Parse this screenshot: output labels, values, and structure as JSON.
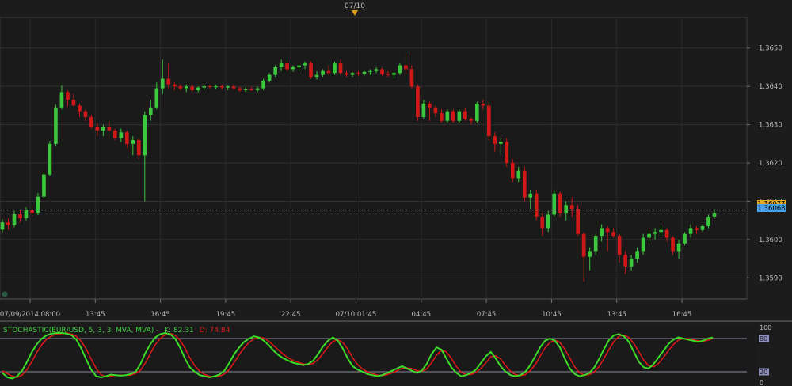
{
  "chart_data": [
    {
      "type": "candlestick",
      "instrument": "EUR/USD",
      "date_marker": "07/10",
      "x_tick_labels": [
        "07/09/2014 08:00",
        "13:45",
        "16:45",
        "19:45",
        "22:45",
        "07/10 01:45",
        "04:45",
        "07:45",
        "10:45",
        "13:45",
        "16:45"
      ],
      "y_ticks": [
        1.359,
        1.36,
        1.361,
        1.362,
        1.363,
        1.364,
        1.365
      ],
      "y_tick_labels": [
        "1.3590",
        "1.3600",
        "1.3610",
        "1.3620",
        "1.3630",
        "1.3640",
        "1.3650"
      ],
      "ylim": [
        1.35845,
        1.3658
      ],
      "last_price_labels": [
        "1.36077",
        "1.36068"
      ],
      "last_price": 1.36077,
      "grid": true,
      "bull_color": "#3cc83c",
      "bear_color": "#d01818",
      "candles": [
        [
          1.36026,
          1.36053,
          1.36019,
          1.36045
        ],
        [
          1.36045,
          1.36055,
          1.36026,
          1.36038
        ],
        [
          1.36038,
          1.36075,
          1.36032,
          1.36066
        ],
        [
          1.36066,
          1.36077,
          1.36044,
          1.36056
        ],
        [
          1.36056,
          1.36084,
          1.3605,
          1.36077
        ],
        [
          1.36077,
          1.36091,
          1.36062,
          1.3607
        ],
        [
          1.3607,
          1.36122,
          1.36064,
          1.36112
        ],
        [
          1.36112,
          1.36178,
          1.36108,
          1.3617
        ],
        [
          1.3617,
          1.36258,
          1.36166,
          1.3625
        ],
        [
          1.3625,
          1.36352,
          1.36245,
          1.36345
        ],
        [
          1.36345,
          1.36402,
          1.3634,
          1.36385
        ],
        [
          1.36385,
          1.3639,
          1.36348,
          1.36365
        ],
        [
          1.36365,
          1.3638,
          1.36348,
          1.3635
        ],
        [
          1.3635,
          1.36355,
          1.3632,
          1.36335
        ],
        [
          1.36335,
          1.3634,
          1.3631,
          1.3632
        ],
        [
          1.3632,
          1.36325,
          1.3629,
          1.36295
        ],
        [
          1.36295,
          1.36305,
          1.3627,
          1.36285
        ],
        [
          1.36285,
          1.363,
          1.3627,
          1.36295
        ],
        [
          1.36295,
          1.3631,
          1.3628,
          1.36285
        ],
        [
          1.36285,
          1.3629,
          1.3626,
          1.36265
        ],
        [
          1.36265,
          1.3629,
          1.36255,
          1.3628
        ],
        [
          1.3628,
          1.36285,
          1.3624,
          1.3625
        ],
        [
          1.3625,
          1.3627,
          1.3622,
          1.3626
        ],
        [
          1.3626,
          1.36265,
          1.3621,
          1.3622
        ],
        [
          1.3622,
          1.36335,
          1.361,
          1.36325
        ],
        [
          1.36325,
          1.36365,
          1.3631,
          1.36345
        ],
        [
          1.36345,
          1.3641,
          1.3634,
          1.36395
        ],
        [
          1.36395,
          1.3647,
          1.3638,
          1.3642
        ],
        [
          1.3642,
          1.3646,
          1.36395,
          1.36405
        ],
        [
          1.36405,
          1.3641,
          1.3639,
          1.364
        ],
        [
          1.364,
          1.36405,
          1.3639,
          1.36395
        ],
        [
          1.36395,
          1.36405,
          1.36385,
          1.364
        ],
        [
          1.364,
          1.36405,
          1.36385,
          1.3639
        ],
        [
          1.3639,
          1.364,
          1.36385,
          1.36397
        ],
        [
          1.36397,
          1.36405,
          1.3639,
          1.364
        ],
        [
          1.364,
          1.36405,
          1.36395,
          1.36398
        ],
        [
          1.36398,
          1.36405,
          1.36393,
          1.364
        ],
        [
          1.364,
          1.36405,
          1.36392,
          1.36397
        ],
        [
          1.36397,
          1.36402,
          1.3639,
          1.364
        ],
        [
          1.364,
          1.36405,
          1.36392,
          1.36395
        ],
        [
          1.36395,
          1.364,
          1.36385,
          1.3639
        ],
        [
          1.3639,
          1.36398,
          1.36385,
          1.36393
        ],
        [
          1.36393,
          1.36398,
          1.36388,
          1.3639
        ],
        [
          1.3639,
          1.364,
          1.36385,
          1.36395
        ],
        [
          1.36395,
          1.3642,
          1.3639,
          1.36415
        ],
        [
          1.36415,
          1.36435,
          1.3641,
          1.3643
        ],
        [
          1.3643,
          1.36455,
          1.36425,
          1.3645
        ],
        [
          1.3645,
          1.3647,
          1.3644,
          1.3646
        ],
        [
          1.3646,
          1.36468,
          1.3644,
          1.36445
        ],
        [
          1.36445,
          1.36455,
          1.36438,
          1.3645
        ],
        [
          1.3645,
          1.3646,
          1.3644,
          1.36455
        ],
        [
          1.36455,
          1.36465,
          1.36445,
          1.3646
        ],
        [
          1.3646,
          1.36465,
          1.3642,
          1.36425
        ],
        [
          1.36425,
          1.3644,
          1.36418,
          1.3643
        ],
        [
          1.3643,
          1.36445,
          1.36425,
          1.3644
        ],
        [
          1.3644,
          1.36455,
          1.3643,
          1.36435
        ],
        [
          1.36435,
          1.36465,
          1.3643,
          1.3646
        ],
        [
          1.3646,
          1.3647,
          1.3643,
          1.36435
        ],
        [
          1.36435,
          1.3644,
          1.36425,
          1.3643
        ],
        [
          1.3643,
          1.36438,
          1.36425,
          1.36435
        ],
        [
          1.36435,
          1.3644,
          1.36428,
          1.36433
        ],
        [
          1.36433,
          1.3644,
          1.36428,
          1.36438
        ],
        [
          1.36438,
          1.36445,
          1.3643,
          1.3644
        ],
        [
          1.3644,
          1.3645,
          1.36435,
          1.36445
        ],
        [
          1.36445,
          1.3645,
          1.36428,
          1.36432
        ],
        [
          1.36432,
          1.3644,
          1.36425,
          1.3643
        ],
        [
          1.3643,
          1.3644,
          1.3642,
          1.36435
        ],
        [
          1.36435,
          1.3646,
          1.3643,
          1.36455
        ],
        [
          1.36455,
          1.3649,
          1.3643,
          1.36445
        ],
        [
          1.36445,
          1.36455,
          1.36395,
          1.364
        ],
        [
          1.364,
          1.36405,
          1.3631,
          1.3632
        ],
        [
          1.3632,
          1.36365,
          1.36315,
          1.36355
        ],
        [
          1.36355,
          1.3636,
          1.3631,
          1.36345
        ],
        [
          1.36345,
          1.3635,
          1.3632,
          1.3633
        ],
        [
          1.3633,
          1.3634,
          1.36305,
          1.3631
        ],
        [
          1.3631,
          1.3634,
          1.36305,
          1.36335
        ],
        [
          1.36335,
          1.3634,
          1.36305,
          1.3631
        ],
        [
          1.3631,
          1.3634,
          1.36305,
          1.36335
        ],
        [
          1.36335,
          1.36345,
          1.3631,
          1.36315
        ],
        [
          1.36315,
          1.3632,
          1.363,
          1.3631
        ],
        [
          1.3631,
          1.3636,
          1.36305,
          1.36355
        ],
        [
          1.36355,
          1.36365,
          1.3634,
          1.3635
        ],
        [
          1.3635,
          1.3636,
          1.3626,
          1.3627
        ],
        [
          1.3627,
          1.3628,
          1.3623,
          1.3625
        ],
        [
          1.3625,
          1.36265,
          1.3622,
          1.36255
        ],
        [
          1.36255,
          1.36265,
          1.3619,
          1.362
        ],
        [
          1.362,
          1.3621,
          1.3615,
          1.3616
        ],
        [
          1.3616,
          1.3619,
          1.3615,
          1.3618
        ],
        [
          1.3618,
          1.3619,
          1.361,
          1.3611
        ],
        [
          1.3611,
          1.3613,
          1.3608,
          1.3612
        ],
        [
          1.3612,
          1.3613,
          1.3605,
          1.3606
        ],
        [
          1.3606,
          1.3607,
          1.3601,
          1.3603
        ],
        [
          1.3603,
          1.36075,
          1.3602,
          1.36065
        ],
        [
          1.36065,
          1.3613,
          1.3606,
          1.3612
        ],
        [
          1.3612,
          1.36125,
          1.3606,
          1.3607
        ],
        [
          1.3607,
          1.361,
          1.3605,
          1.3609
        ],
        [
          1.3609,
          1.3611,
          1.3606,
          1.3608
        ],
        [
          1.3608,
          1.3609,
          1.3601,
          1.36015
        ],
        [
          1.36015,
          1.3602,
          1.3589,
          1.35955
        ],
        [
          1.35955,
          1.3598,
          1.3592,
          1.3597
        ],
        [
          1.3597,
          1.36015,
          1.3596,
          1.3601
        ],
        [
          1.3601,
          1.3604,
          1.35995,
          1.3603
        ],
        [
          1.3603,
          1.36035,
          1.3597,
          1.3602
        ],
        [
          1.3602,
          1.3603,
          1.36005,
          1.3601
        ],
        [
          1.3601,
          1.36015,
          1.3594,
          1.3596
        ],
        [
          1.3596,
          1.3597,
          1.3591,
          1.3593
        ],
        [
          1.3593,
          1.3596,
          1.3592,
          1.3595
        ],
        [
          1.3595,
          1.3598,
          1.3594,
          1.3597
        ],
        [
          1.3597,
          1.36015,
          1.3596,
          1.36005
        ],
        [
          1.36005,
          1.36025,
          1.35995,
          1.36015
        ],
        [
          1.36015,
          1.3603,
          1.36,
          1.3602
        ],
        [
          1.3602,
          1.36035,
          1.3601,
          1.36025
        ],
        [
          1.36025,
          1.3603,
          1.35995,
          1.36005
        ],
        [
          1.36005,
          1.3601,
          1.3596,
          1.3597
        ],
        [
          1.3597,
          1.36,
          1.3595,
          1.3599
        ],
        [
          1.3599,
          1.3602,
          1.35985,
          1.36015
        ],
        [
          1.36015,
          1.3604,
          1.36005,
          1.3603
        ],
        [
          1.3603,
          1.36035,
          1.36015,
          1.36025
        ],
        [
          1.36025,
          1.3604,
          1.3602,
          1.36035
        ],
        [
          1.36035,
          1.36065,
          1.3603,
          1.3606
        ],
        [
          1.3606,
          1.3608,
          1.36055,
          1.3607
        ]
      ]
    },
    {
      "type": "line",
      "indicator_label": "STOCHASTIC(EUR/USD, 5, 3, 3, MVA, MVA) -",
      "k_label": "K: 82.31",
      "d_label": "D: 74.84",
      "ylim": [
        0,
        100
      ],
      "levels": [
        20,
        80
      ],
      "y_tick_labels": [
        "100",
        "80",
        "20",
        "0"
      ],
      "k_color": "#3cdc28",
      "d_color": "#e01818",
      "series": [
        {
          "name": "K",
          "values": [
            18,
            10,
            8,
            12,
            22,
            38,
            56,
            70,
            80,
            86,
            89,
            90,
            90,
            89,
            86,
            78,
            62,
            42,
            24,
            12,
            10,
            12,
            15,
            14,
            13,
            14,
            16,
            20,
            34,
            54,
            70,
            82,
            88,
            90,
            88,
            80,
            64,
            44,
            28,
            20,
            14,
            12,
            10,
            12,
            15,
            22,
            36,
            52,
            64,
            74,
            80,
            84,
            82,
            76,
            68,
            58,
            50,
            44,
            40,
            36,
            34,
            32,
            34,
            40,
            52,
            66,
            76,
            82,
            76,
            62,
            44,
            30,
            24,
            20,
            16,
            14,
            12,
            14,
            18,
            22,
            26,
            30,
            26,
            22,
            18,
            22,
            34,
            52,
            64,
            60,
            44,
            28,
            18,
            12,
            14,
            18,
            24,
            36,
            48,
            56,
            44,
            30,
            20,
            14,
            12,
            14,
            20,
            32,
            48,
            64,
            76,
            80,
            76,
            64,
            44,
            26,
            16,
            12,
            14,
            18,
            28,
            44,
            62,
            78,
            86,
            88,
            84,
            74,
            56,
            38,
            28,
            26,
            34,
            46,
            58,
            70,
            78,
            82,
            80,
            78,
            76,
            74,
            76,
            80,
            82
          ]
        },
        {
          "name": "D",
          "values": [
            22,
            17,
            12,
            10,
            14,
            24,
            39,
            55,
            69,
            79,
            85,
            88,
            89,
            90,
            88,
            84,
            75,
            61,
            43,
            26,
            15,
            11,
            12,
            14,
            14,
            14,
            14,
            17,
            23,
            36,
            53,
            69,
            80,
            87,
            89,
            86,
            77,
            63,
            45,
            31,
            21,
            15,
            12,
            11,
            12,
            16,
            24,
            37,
            51,
            63,
            73,
            79,
            82,
            81,
            75,
            67,
            59,
            51,
            45,
            40,
            37,
            34,
            33,
            35,
            42,
            53,
            65,
            75,
            78,
            73,
            61,
            45,
            33,
            25,
            20,
            17,
            14,
            13,
            15,
            18,
            22,
            26,
            27,
            26,
            22,
            21,
            25,
            36,
            50,
            59,
            56,
            44,
            30,
            19,
            15,
            15,
            19,
            26,
            36,
            47,
            49,
            43,
            31,
            21,
            15,
            13,
            15,
            22,
            33,
            48,
            63,
            73,
            77,
            73,
            61,
            45,
            29,
            18,
            14,
            15,
            20,
            30,
            45,
            61,
            75,
            84,
            86,
            82,
            71,
            56,
            41,
            31,
            29,
            35,
            46,
            58,
            69,
            77,
            80,
            80,
            78,
            76,
            75,
            77,
            80
          ]
        }
      ]
    }
  ]
}
